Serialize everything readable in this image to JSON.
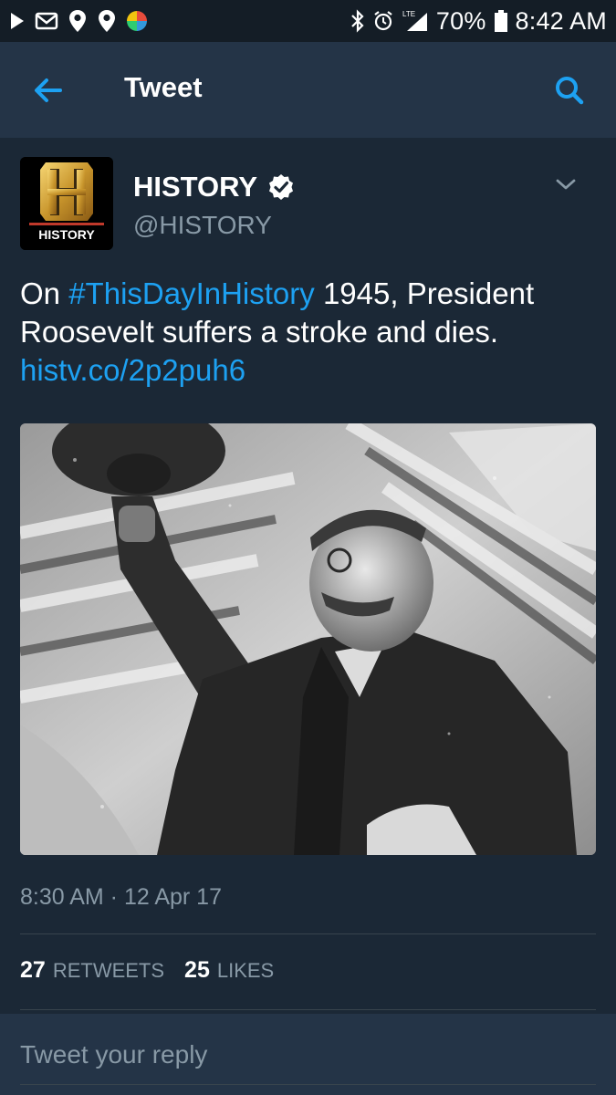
{
  "status_bar": {
    "battery": "70%",
    "time": "8:42 AM",
    "network": "LTE",
    "icons_left": [
      "play-icon",
      "gmail-icon",
      "location-pin-icon",
      "location-pin-icon",
      "app-icon"
    ],
    "icons_right": [
      "bluetooth-icon",
      "alarm-icon",
      "signal-icon",
      "battery-icon"
    ]
  },
  "header": {
    "title": "Tweet",
    "back_icon": "arrow-left-icon",
    "search_icon": "search-icon"
  },
  "tweet": {
    "author": {
      "avatar_text": "HISTORY",
      "avatar_letter": "H",
      "display_name": "HISTORY",
      "handle": "@HISTORY",
      "verified": true
    },
    "text_prefix": "On ",
    "hashtag": "#ThisDayInHistory",
    "text_suffix": " 1945, President Roosevelt suffers a stroke and dies.",
    "link": "histv.co/2p2puh6",
    "timestamp": "8:30 AM · 12 Apr 17",
    "retweets_count": "27",
    "retweets_label": "RETWEETS",
    "likes_count": "25",
    "likes_label": "LIKES"
  },
  "reply": {
    "placeholder": "Tweet your reply"
  },
  "colors": {
    "background": "#1b2836",
    "header": "#243447",
    "status_bar": "#141d26",
    "accent": "#1da1f2",
    "secondary_text": "#8899a6",
    "divider": "#38444d"
  }
}
